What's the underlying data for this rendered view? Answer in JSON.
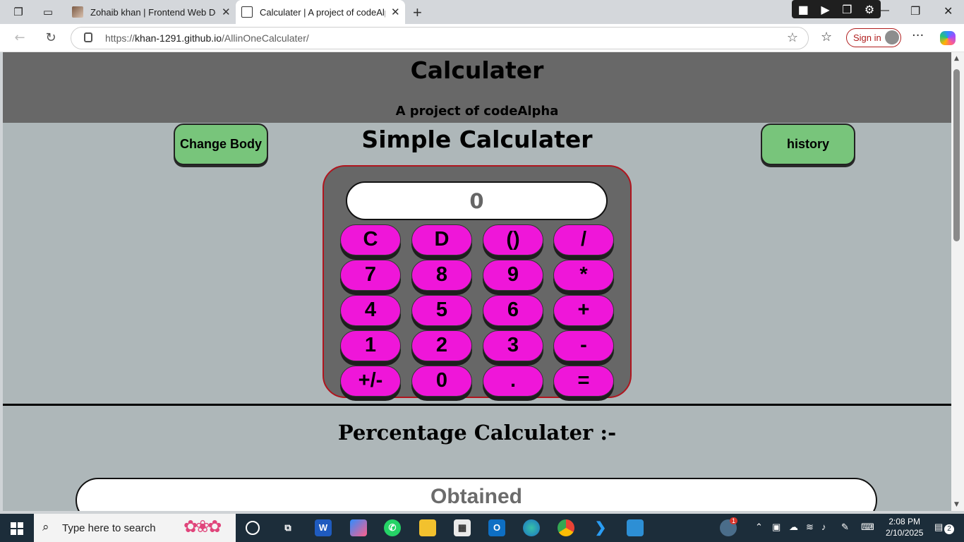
{
  "browser": {
    "tabs": [
      {
        "title": "Zohaib khan | Frontend Web Deve",
        "active": false
      },
      {
        "title": "Calculater | A project of codeAlph",
        "active": true
      }
    ],
    "url_prefix": "https://",
    "url_host": "khan-1291.github.io",
    "url_path": "/AllinOneCalculater/",
    "signin_label": "Sign in"
  },
  "page": {
    "title": "Calculater",
    "subtitle": "A project of codeAlpha",
    "change_body_label": "Change Body",
    "history_label": "history",
    "section_title": "Simple Calculater",
    "display_value": "0",
    "keys": [
      "C",
      "D",
      "()",
      "/",
      "7",
      "8",
      "9",
      "*",
      "4",
      "5",
      "6",
      "+",
      "1",
      "2",
      "3",
      "-",
      "+/-",
      "0",
      ".",
      "="
    ],
    "percentage_title": "Percentage Calculater :-",
    "obtained_placeholder": "Obtained"
  },
  "taskbar": {
    "search_placeholder": "Type here to search",
    "time": "2:08 PM",
    "date": "2/10/2025",
    "notification_count": "2",
    "weather_badge": "1"
  },
  "colors": {
    "header_bg": "#686868",
    "content_bg": "#aeb7b9",
    "green_button": "#78c57b",
    "key_magenta": "#ef16d9",
    "calc_border": "#b0151e"
  }
}
